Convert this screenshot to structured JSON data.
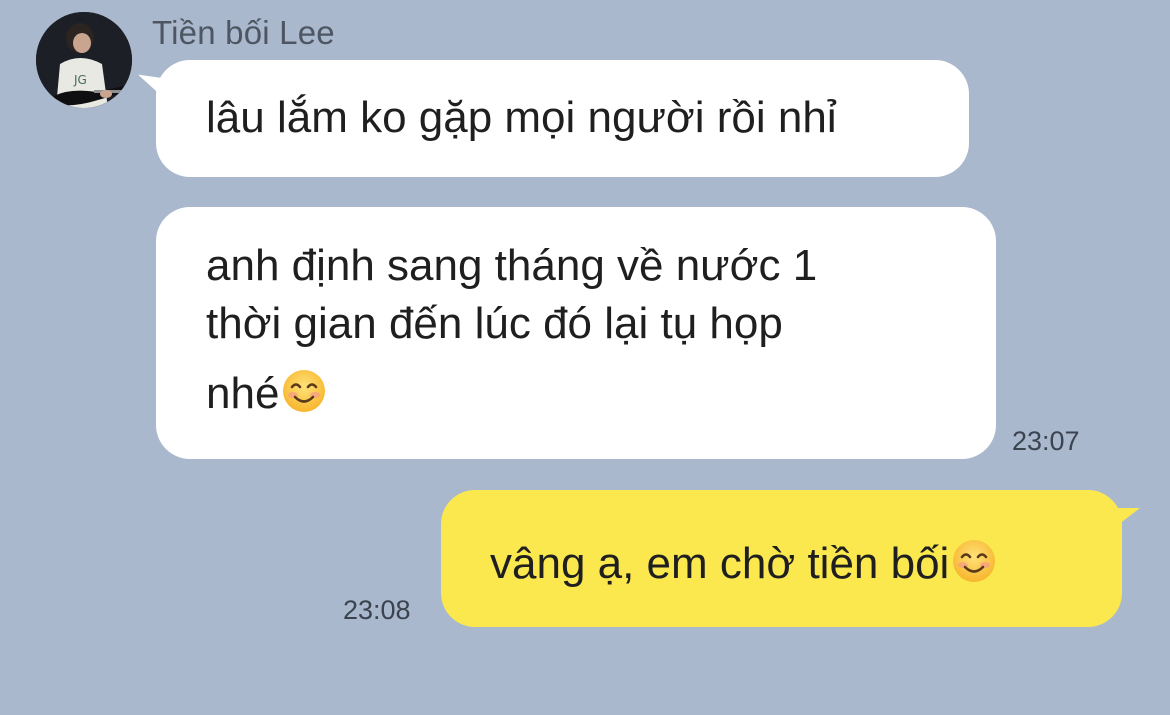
{
  "chat": {
    "sender_name": "Tiền bối Lee",
    "messages": [
      {
        "direction": "incoming",
        "lines": [
          "lâu lắm ko gặp mọi người rồi nhỉ"
        ],
        "time": ""
      },
      {
        "direction": "incoming",
        "lines": [
          "anh định sang tháng về nước 1",
          "thời gian đến lúc đó lại tụ họp",
          "nhé"
        ],
        "emoji": "smiling-face-emoji",
        "time": "23:07"
      },
      {
        "direction": "outgoing",
        "lines": [
          "vâng ạ, em chờ tiền bối"
        ],
        "emoji": "smiling-face-emoji",
        "time": "23:08"
      }
    ]
  },
  "colors": {
    "background": "#a9b8cc",
    "incoming_bubble": "#ffffff",
    "outgoing_bubble": "#fbe84e",
    "name_text": "#4e5663",
    "time_text": "#3b4350"
  }
}
